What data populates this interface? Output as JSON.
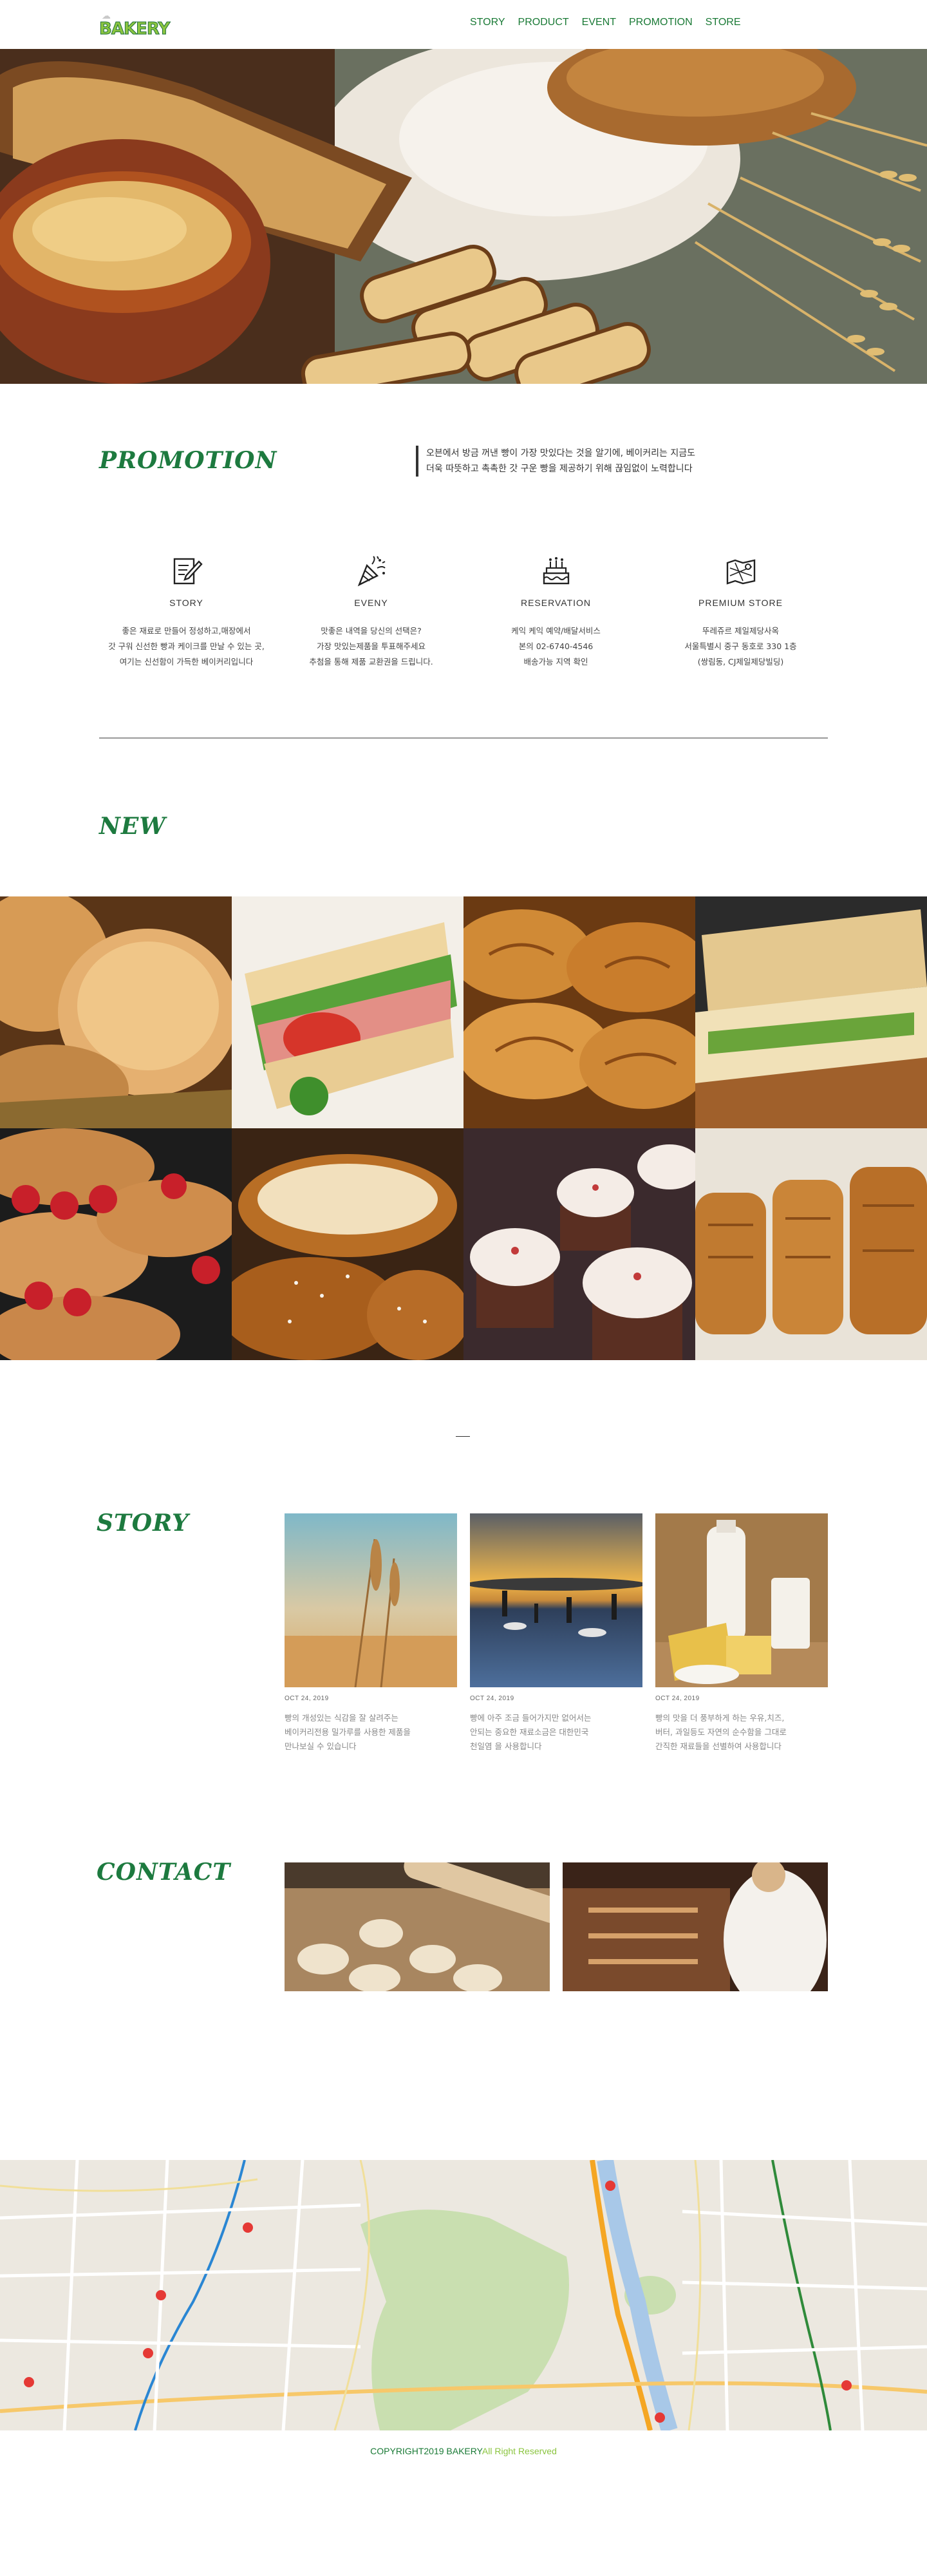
{
  "header": {
    "logo": "BAKERY",
    "nav": [
      {
        "label": "STORY"
      },
      {
        "label": "PRODUCT"
      },
      {
        "label": "EVENT"
      },
      {
        "label": "PROMOTION"
      },
      {
        "label": "STORE"
      }
    ]
  },
  "promotion": {
    "title": "PROMOTION",
    "description_line1": "오븐에서 방금 꺼낸 빵이 가장 맛있다는 것을 알기에, 베이커리는 지금도",
    "description_line2": "더욱 따뜻하고 촉촉한 갓 구운 빵을 제공하기 위해 끊임없이 노력합니다",
    "features": [
      {
        "icon": "note-pencil-icon",
        "title": "STORY",
        "text": "좋은 재료로 만들어 정성하고,매장에서\n갓 구워 신선한 빵과 케이크를 만날 수 있는 곳,\n여기는 신선함이 가득한 베이커리입니다"
      },
      {
        "icon": "party-popper-icon",
        "title": "EVENY",
        "text": "맛좋은 내역을 당신의 선택은?\n가장 맛있는제품을 투표해주세요\n추첨을 통해 제품 교환권을 드립니다."
      },
      {
        "icon": "birthday-cake-icon",
        "title": "RESERVATION",
        "text": "케익 케익 예약/배달서비스\n본의 02-6740-4546\n배송가능 지역 확인"
      },
      {
        "icon": "store-map-icon",
        "title": "PREMIUM STORE",
        "text": "뚜레쥬르 제일제당사옥\n서울특별시 중구 동호로 330 1층\n(쌍림동, CJ제일제당빌딩)"
      }
    ]
  },
  "new_section": {
    "title": "NEW",
    "tiles": [
      "bread-rolls-image",
      "sandwich-image",
      "croissants-image",
      "panini-image",
      "strawberry-croissant-image",
      "pretzel-image",
      "cupcakes-image",
      "loaf-bread-image"
    ]
  },
  "story": {
    "title": "STORY",
    "cards": [
      {
        "image": "wheat-image",
        "date": "OCT 24, 2019",
        "text": "빵의 개성있는 식감을 잘 살려주는\n베이커리전용 밀가루를 사용한 제품을\n만나보실 수 있습니다"
      },
      {
        "image": "salt-field-image",
        "date": "OCT 24, 2019",
        "text": "빵에 아주 조금 들어가지만 없어서는\n안되는 중요한 재료소금은 대한민국\n천일염 을 사용합니다"
      },
      {
        "image": "dairy-image",
        "date": "OCT 24, 2019",
        "text": "빵의 맛을 더 풍부하게 하는 우유,치즈,\n버터, 과일등도 자연의 순수함을 그대로\n간직한 재료들을 선별하여 사용합니다"
      }
    ]
  },
  "contact": {
    "title": "CONTACT",
    "images": [
      "dough-rolling-image",
      "baker-oven-image"
    ]
  },
  "footer": {
    "copyright": "COPYRIGHT2019 BAKERY",
    "rights": "All Right Reserved"
  },
  "colors": {
    "brand_green": "#1d7a3f",
    "light_green": "#8bc540"
  }
}
